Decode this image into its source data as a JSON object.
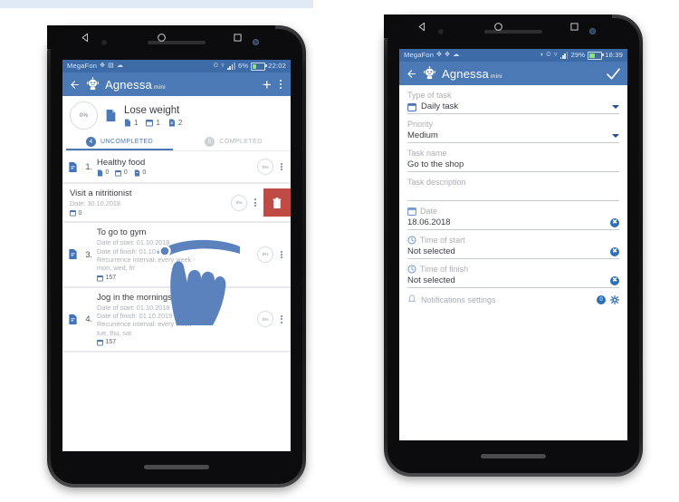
{
  "left_phone": {
    "status_bar": {
      "carrier": "MegaFon",
      "battery_percent": "6%",
      "time": "22:02",
      "icons": [
        "bluetooth-icon",
        "sim-icon",
        "cloud-icon",
        "alarm-icon",
        "wifi-icon",
        "signal-icon",
        "battery-icon"
      ]
    },
    "app_bar": {
      "back_label": "back-arrow",
      "brand": "Agnessa",
      "brand_suffix": "mini",
      "add_label": "+",
      "menu_label": "overflow-menu"
    },
    "goal": {
      "progress": "0%",
      "title": "Lose weight",
      "counts": [
        {
          "icon": "doc-icon",
          "value": "1"
        },
        {
          "icon": "calendar-icon",
          "value": "1"
        },
        {
          "icon": "repeat-doc-icon",
          "value": "2"
        }
      ]
    },
    "tabs": [
      {
        "label": "UNCOMPLETED",
        "badge": "4",
        "active": true
      },
      {
        "label": "COMPLETED",
        "badge": "0",
        "active": false
      }
    ],
    "tasks": [
      {
        "number": "1.",
        "title": "Healthy food",
        "lines": [],
        "counts": [
          {
            "icon": "doc-icon",
            "value": "0"
          },
          {
            "icon": "calendar-icon",
            "value": "0"
          },
          {
            "icon": "repeat-doc-icon",
            "value": "0"
          }
        ],
        "progress": "0%",
        "swiped": false
      },
      {
        "number": "",
        "title": "Visit a nitritionist",
        "lines": [
          "Date: 30.10.2018"
        ],
        "counts": [
          {
            "icon": "calendar-icon",
            "value": "0"
          }
        ],
        "progress": "0%",
        "swiped": true,
        "delete_label": "trash-icon"
      },
      {
        "number": "3.",
        "title": "To go to gym",
        "lines": [
          "Date of start: 01.10.2018",
          "Date of finish: 01.10.2019",
          "Recurrence interval: every week -",
          "mon, wed, fri"
        ],
        "counts": [
          {
            "icon": "calendar-icon",
            "value": "157"
          }
        ],
        "progress": "0%",
        "swiped": false
      },
      {
        "number": "4.",
        "title": "Jog in the mornings",
        "lines": [
          "Date of start: 01.10.2018",
          "Date of finish: 01.10.2019",
          "Recurrence interval: every week -",
          "tue, thu, sat"
        ],
        "counts": [
          {
            "icon": "calendar-icon",
            "value": "157"
          }
        ],
        "progress": "0%",
        "swiped": false
      }
    ],
    "nav_bar": [
      "back-triangle-icon",
      "home-circle-icon",
      "recents-square-icon"
    ]
  },
  "right_phone": {
    "status_bar": {
      "carrier": "MegaFon",
      "battery_percent": "29%",
      "time": "18:39",
      "icons": [
        "bluetooth-icon",
        "sim-icon",
        "cloud-icon",
        "mute-icon",
        "alarm-icon",
        "wifi-icon",
        "signal-icon",
        "battery-icon"
      ]
    },
    "app_bar": {
      "back_label": "back-arrow",
      "brand": "Agnessa",
      "brand_suffix": "mini",
      "confirm_label": "check-icon"
    },
    "form": {
      "type_of_task": {
        "label": "Type of task",
        "value": "Daily task",
        "icon": "calendar-icon"
      },
      "priority": {
        "label": "Priority",
        "value": "Medium"
      },
      "task_name": {
        "label": "Task name",
        "value": "Go to the shop"
      },
      "task_description": {
        "label": "Task description",
        "value": ""
      },
      "date": {
        "label": "Date",
        "value": "18.06.2018",
        "icon": "calendar-icon",
        "clear": "✖"
      },
      "time_of_start": {
        "label": "Time of start",
        "value": "Not selected",
        "icon": "clock-icon",
        "clear": "✖"
      },
      "time_of_finish": {
        "label": "Time of finish",
        "value": "Not selected",
        "icon": "clock-icon",
        "clear": "✖"
      },
      "notifications": {
        "label": "Notifications settings",
        "icon": "bell-icon",
        "badge": "0",
        "settings_icon": "gear-icon"
      }
    },
    "nav_bar": [
      "back-triangle-icon",
      "home-circle-icon",
      "recents-square-icon"
    ]
  },
  "colors": {
    "appbar": "#4a79b5",
    "statusbar": "#3c6ba8",
    "accent": "#2f6fb5",
    "delete": "#c04a44",
    "hand": "#5b82bd"
  }
}
